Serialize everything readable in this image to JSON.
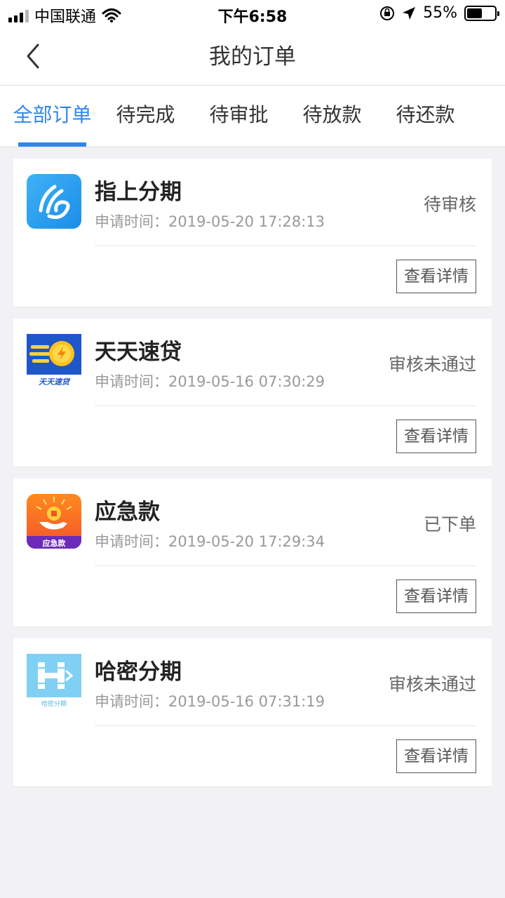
{
  "status_bar": {
    "carrier": "中国联通",
    "time": "下午6:58",
    "battery": "55%",
    "battery_level": 0.55
  },
  "nav": {
    "title": "我的订单"
  },
  "tabs": [
    {
      "label": "全部订单",
      "active": true
    },
    {
      "label": "待完成"
    },
    {
      "label": "待审批"
    },
    {
      "label": "待放款"
    },
    {
      "label": "待还款"
    }
  ],
  "orders": [
    {
      "name": "指上分期",
      "time_label": "申请时间：",
      "time": "2019-05-20 17:28:13",
      "status": "待审核",
      "button": "查看详情",
      "logo_icon": "zhishang-logo-icon"
    },
    {
      "name": "天天速贷",
      "time_label": "申请时间：",
      "time": "2019-05-16 07:30:29",
      "status": "审核未通过",
      "button": "查看详情",
      "logo_icon": "tiantian-logo-icon",
      "logo_text": "天天速贷"
    },
    {
      "name": "应急款",
      "time_label": "申请时间：",
      "time": "2019-05-20 17:29:34",
      "status": "已下单",
      "button": "查看详情",
      "logo_icon": "yingji-logo-icon",
      "logo_text": "应急款"
    },
    {
      "name": "哈密分期",
      "time_label": "申请时间：",
      "time": "2019-05-16 07:31:19",
      "status": "审核未通过",
      "button": "查看详情",
      "logo_icon": "hami-logo-icon",
      "logo_text": "哈密分期"
    }
  ],
  "colors": {
    "accent": "#2e86ee",
    "background": "#f2f2f4"
  }
}
